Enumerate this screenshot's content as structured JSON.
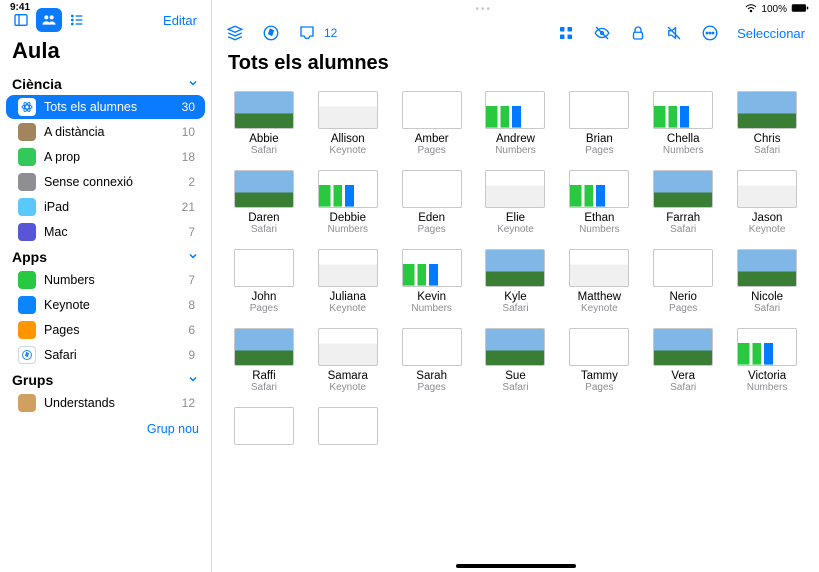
{
  "status": {
    "time": "9:41",
    "battery": "100%"
  },
  "sidebar": {
    "edit": "Editar",
    "title": "Aula",
    "sections": [
      {
        "header": "Ciència",
        "items": [
          {
            "id": "all",
            "label": "Tots els alumnes",
            "count": "30",
            "icon": "atom",
            "selected": true
          },
          {
            "id": "dist",
            "label": "A distància",
            "count": "10",
            "icon": "dist"
          },
          {
            "id": "prop",
            "label": "A prop",
            "count": "18",
            "icon": "prop"
          },
          {
            "id": "off",
            "label": "Sense connexió",
            "count": "2",
            "icon": "off"
          },
          {
            "id": "ipad",
            "label": "iPad",
            "count": "21",
            "icon": "ipad"
          },
          {
            "id": "mac",
            "label": "Mac",
            "count": "7",
            "icon": "mac"
          }
        ]
      },
      {
        "header": "Apps",
        "items": [
          {
            "id": "numbers",
            "label": "Numbers",
            "count": "7",
            "icon": "numbers"
          },
          {
            "id": "keynote",
            "label": "Keynote",
            "count": "8",
            "icon": "keynote"
          },
          {
            "id": "pages",
            "label": "Pages",
            "count": "6",
            "icon": "pages"
          },
          {
            "id": "safari",
            "label": "Safari",
            "count": "9",
            "icon": "safari"
          }
        ]
      },
      {
        "header": "Grups",
        "items": [
          {
            "id": "und",
            "label": "Understands",
            "count": "12",
            "icon": "avatar"
          }
        ]
      }
    ],
    "new_group": "Grup nou"
  },
  "toolbar": {
    "inbox_badge": "12",
    "select": "Seleccionar"
  },
  "main": {
    "title": "Tots els alumnes",
    "students": [
      {
        "name": "Abbie",
        "app": "Safari"
      },
      {
        "name": "Allison",
        "app": "Keynote"
      },
      {
        "name": "Amber",
        "app": "Pages"
      },
      {
        "name": "Andrew",
        "app": "Numbers"
      },
      {
        "name": "Brian",
        "app": "Pages"
      },
      {
        "name": "Chella",
        "app": "Numbers"
      },
      {
        "name": "Chris",
        "app": "Safari"
      },
      {
        "name": "Daren",
        "app": "Safari"
      },
      {
        "name": "Debbie",
        "app": "Numbers"
      },
      {
        "name": "Eden",
        "app": "Pages"
      },
      {
        "name": "Elie",
        "app": "Keynote"
      },
      {
        "name": "Ethan",
        "app": "Numbers"
      },
      {
        "name": "Farrah",
        "app": "Safari"
      },
      {
        "name": "Jason",
        "app": "Keynote"
      },
      {
        "name": "John",
        "app": "Pages"
      },
      {
        "name": "Juliana",
        "app": "Keynote"
      },
      {
        "name": "Kevin",
        "app": "Numbers"
      },
      {
        "name": "Kyle",
        "app": "Safari"
      },
      {
        "name": "Matthew",
        "app": "Keynote"
      },
      {
        "name": "Nerio",
        "app": "Pages"
      },
      {
        "name": "Nicole",
        "app": "Safari"
      },
      {
        "name": "Raffi",
        "app": "Safari"
      },
      {
        "name": "Samara",
        "app": "Keynote"
      },
      {
        "name": "Sarah",
        "app": "Pages"
      },
      {
        "name": "Sue",
        "app": "Safari"
      },
      {
        "name": "Tammy",
        "app": "Pages"
      },
      {
        "name": "Vera",
        "app": "Safari"
      },
      {
        "name": "Victoria",
        "app": "Numbers"
      },
      {
        "name": "",
        "app": ""
      },
      {
        "name": "",
        "app": ""
      }
    ]
  }
}
